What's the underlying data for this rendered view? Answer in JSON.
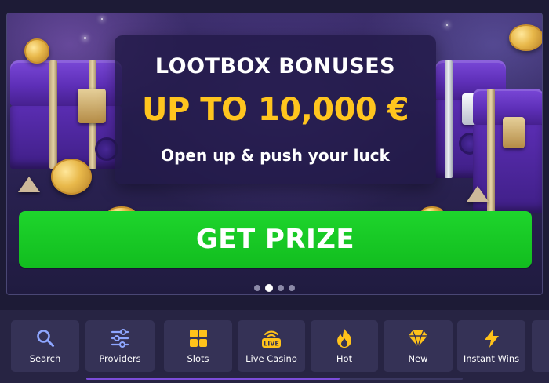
{
  "banner": {
    "title": "LOOTBOX BONUSES",
    "amount": "UP TO 10,000 €",
    "subtitle": "Open up & push your luck",
    "cta_label": "GET PRIZE",
    "carousel": {
      "total": 4,
      "active": 2
    },
    "colors": {
      "amount": "#ffc51e",
      "cta": "#14c322"
    }
  },
  "categories": [
    {
      "label": "Search",
      "icon": "search-icon"
    },
    {
      "label": "Providers",
      "icon": "sliders-icon"
    },
    {
      "label": "Slots",
      "icon": "slots-grid-icon"
    },
    {
      "label": "Live Casino",
      "icon": "live-casino-icon"
    },
    {
      "label": "Hot",
      "icon": "flame-icon"
    },
    {
      "label": "New",
      "icon": "diamond-icon"
    },
    {
      "label": "Instant Wins",
      "icon": "lightning-icon"
    }
  ],
  "colors": {
    "accent": "#7b4cd9",
    "icon_blue": "#8ea6ff",
    "icon_yellow": "#ffc21a"
  }
}
